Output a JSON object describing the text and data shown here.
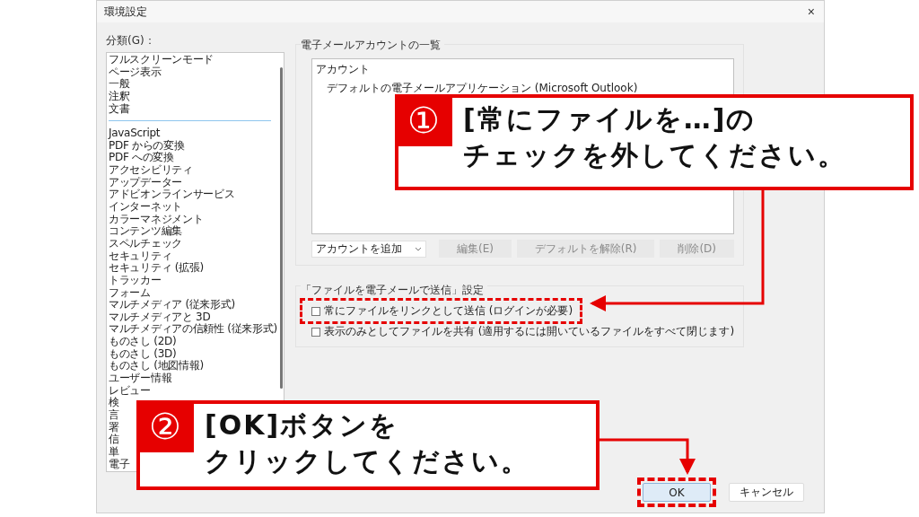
{
  "window": {
    "title": "環境設定",
    "close": "×"
  },
  "categories": {
    "label": "分類(G)：",
    "groups": [
      {
        "items": [
          "フルスクリーンモード",
          "ページ表示",
          "一般",
          "注釈",
          "文書"
        ]
      },
      {
        "items": [
          "JavaScript",
          "PDF からの変換",
          "PDF への変換",
          "アクセシビリティ",
          "アップデーター",
          "アドビオンラインサービス",
          "インターネット",
          "カラーマネジメント",
          "コンテンツ編集",
          "スペルチェック",
          "セキュリティ",
          "セキュリティ (拡張)",
          "トラッカー",
          "フォーム",
          "マルチメディア (従来形式)",
          "マルチメディアと 3D",
          "マルチメディアの信頼性 (従来形式)",
          "ものさし (2D)",
          "ものさし (3D)",
          "ものさし (地図情報)",
          "ユーザー情報",
          "レビュー",
          "検",
          "言",
          "署",
          "信",
          "単",
          "電子"
        ]
      }
    ]
  },
  "accounts": {
    "title": "電子メールアカウントの一覧",
    "heading": "アカウント",
    "items": [
      "デフォルトの電子メールアプリケーション (Microsoft Outlook)"
    ],
    "add_dropdown": "アカウントを追加",
    "buttons": [
      {
        "label": "編集(E)",
        "disabled": true
      },
      {
        "label": "デフォルトを解除(R)",
        "disabled": true
      },
      {
        "label": "削除(D)",
        "disabled": true
      }
    ]
  },
  "send_settings": {
    "title": "「ファイルを電子メールで送信」設定",
    "options": [
      {
        "label": "常にファイルをリンクとして送信 (ログインが必要)",
        "checked": false,
        "highlighted": true
      },
      {
        "label": "表示のみとしてファイルを共有 (適用するには開いているファイルをすべて閉じます)",
        "checked": false,
        "highlighted": false
      }
    ]
  },
  "footer_buttons": [
    {
      "label": "OK",
      "primary": true,
      "highlighted": true
    },
    {
      "label": "キャンセル",
      "primary": false,
      "highlighted": false
    }
  ],
  "callouts": [
    {
      "number": "①",
      "lines": [
        "[常にファイルを…]の",
        "チェックを外してください。"
      ]
    },
    {
      "number": "②",
      "lines": [
        "[OK]ボタンを",
        "クリックしてください。"
      ]
    }
  ]
}
